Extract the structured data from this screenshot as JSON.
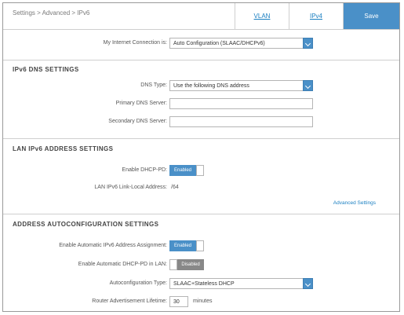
{
  "header": {
    "breadcrumb": "Settings > Advanced > IPv6",
    "tabs": [
      {
        "label": "VLAN",
        "active": false
      },
      {
        "label": "IPv4",
        "active": false
      },
      {
        "label": "Save",
        "active": true
      }
    ]
  },
  "connection": {
    "label": "My Internet Connection is:",
    "value": "Auto Configuration (SLAAC/DHCPv6)"
  },
  "dns": {
    "title": "IPv6 DNS SETTINGS",
    "type_label": "DNS Type:",
    "type_value": "Use the following DNS address",
    "primary_label": "Primary DNS Server:",
    "primary_value": "",
    "secondary_label": "Secondary DNS Server:",
    "secondary_value": ""
  },
  "lan": {
    "title": "LAN IPv6 ADDRESS SETTINGS",
    "dhcp_pd_label": "Enable DHCP-PD:",
    "dhcp_pd_state": "Enabled",
    "link_local_label": "LAN IPv6 Link-Local Address:",
    "link_local_value": "/64",
    "advanced_link": "Advanced Settings"
  },
  "autoconf": {
    "title": "ADDRESS AUTOCONFIGURATION SETTINGS",
    "auto_assign_label": "Enable Automatic IPv6 Address Assignment:",
    "auto_assign_state": "Enabled",
    "auto_pd_label": "Enable Automatic DHCP-PD in LAN:",
    "auto_pd_state": "Disabled",
    "autoconf_type_label": "Autoconfiguration Type:",
    "autoconf_type_value": "SLAAC+Stateless DHCP",
    "ra_lifetime_label": "Router Advertisement Lifetime:",
    "ra_lifetime_value": "30",
    "ra_lifetime_unit": "minutes"
  },
  "colors": {
    "accent": "#4a90c8",
    "disabled": "#888888",
    "link": "#1a7fc1"
  }
}
